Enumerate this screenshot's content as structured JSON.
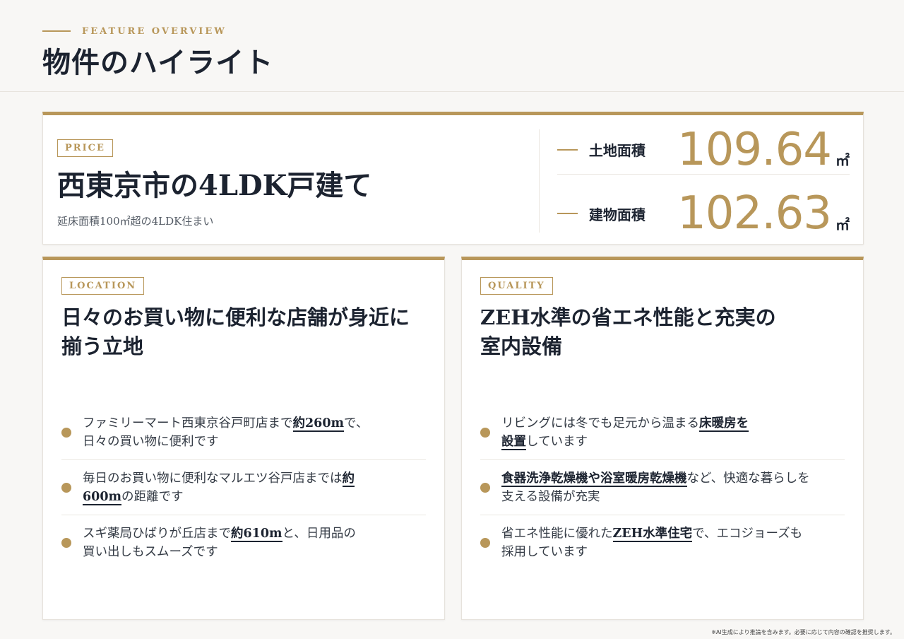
{
  "header": {
    "eyebrow": "FEATURE OVERVIEW",
    "title": "物件のハイライト"
  },
  "price": {
    "tag": "PRICE",
    "title": "西東京市の4LDK戸建て",
    "subtitle": "延床面積100㎡超の4LDK住まい",
    "stats": [
      {
        "label": "土地面積",
        "value": "109.64",
        "unit": "㎡"
      },
      {
        "label": "建物面積",
        "value": "102.63",
        "unit": "㎡"
      }
    ]
  },
  "location": {
    "tag": "LOCATION",
    "title_line1": "日々のお買い物に便利な店舗が身近に",
    "title_line2": "揃う立地",
    "items": [
      {
        "pre": "ファミリーマート西東京谷戸町店まで",
        "em": "約260m",
        "post1": "で、",
        "line2": "日々の買い物に便利です"
      },
      {
        "pre": "毎日のお買い物に便利なマルエツ谷戸店までは",
        "em1": "約",
        "em2": "600m",
        "post": "の距離です"
      },
      {
        "pre": "スギ薬局ひばりが丘店まで",
        "em": "約610m",
        "post1": "と、日用品の",
        "line2": "買い出しもスムーズです"
      }
    ]
  },
  "quality": {
    "tag": "QUALITY",
    "title_line1": "ZEH水準の省エネ性能と充実の",
    "title_line2": "室内設備",
    "items": [
      {
        "pre": "リビングには冬でも足元から温まる",
        "em1": "床暖房を",
        "em2": "設置",
        "post": "しています"
      },
      {
        "em": "食器洗浄乾燥機や浴室暖房乾燥機",
        "post1": "など、快適な暮らしを",
        "line2": "支える設備が充実"
      },
      {
        "pre": "省エネ性能に優れた",
        "em": "ZEH水準住宅",
        "post1": "で、エコジョーズも",
        "line2": "採用しています"
      }
    ]
  },
  "footnote": "※AI生成により推論を含みます。必要に応じて内容の確認を推奨します。"
}
